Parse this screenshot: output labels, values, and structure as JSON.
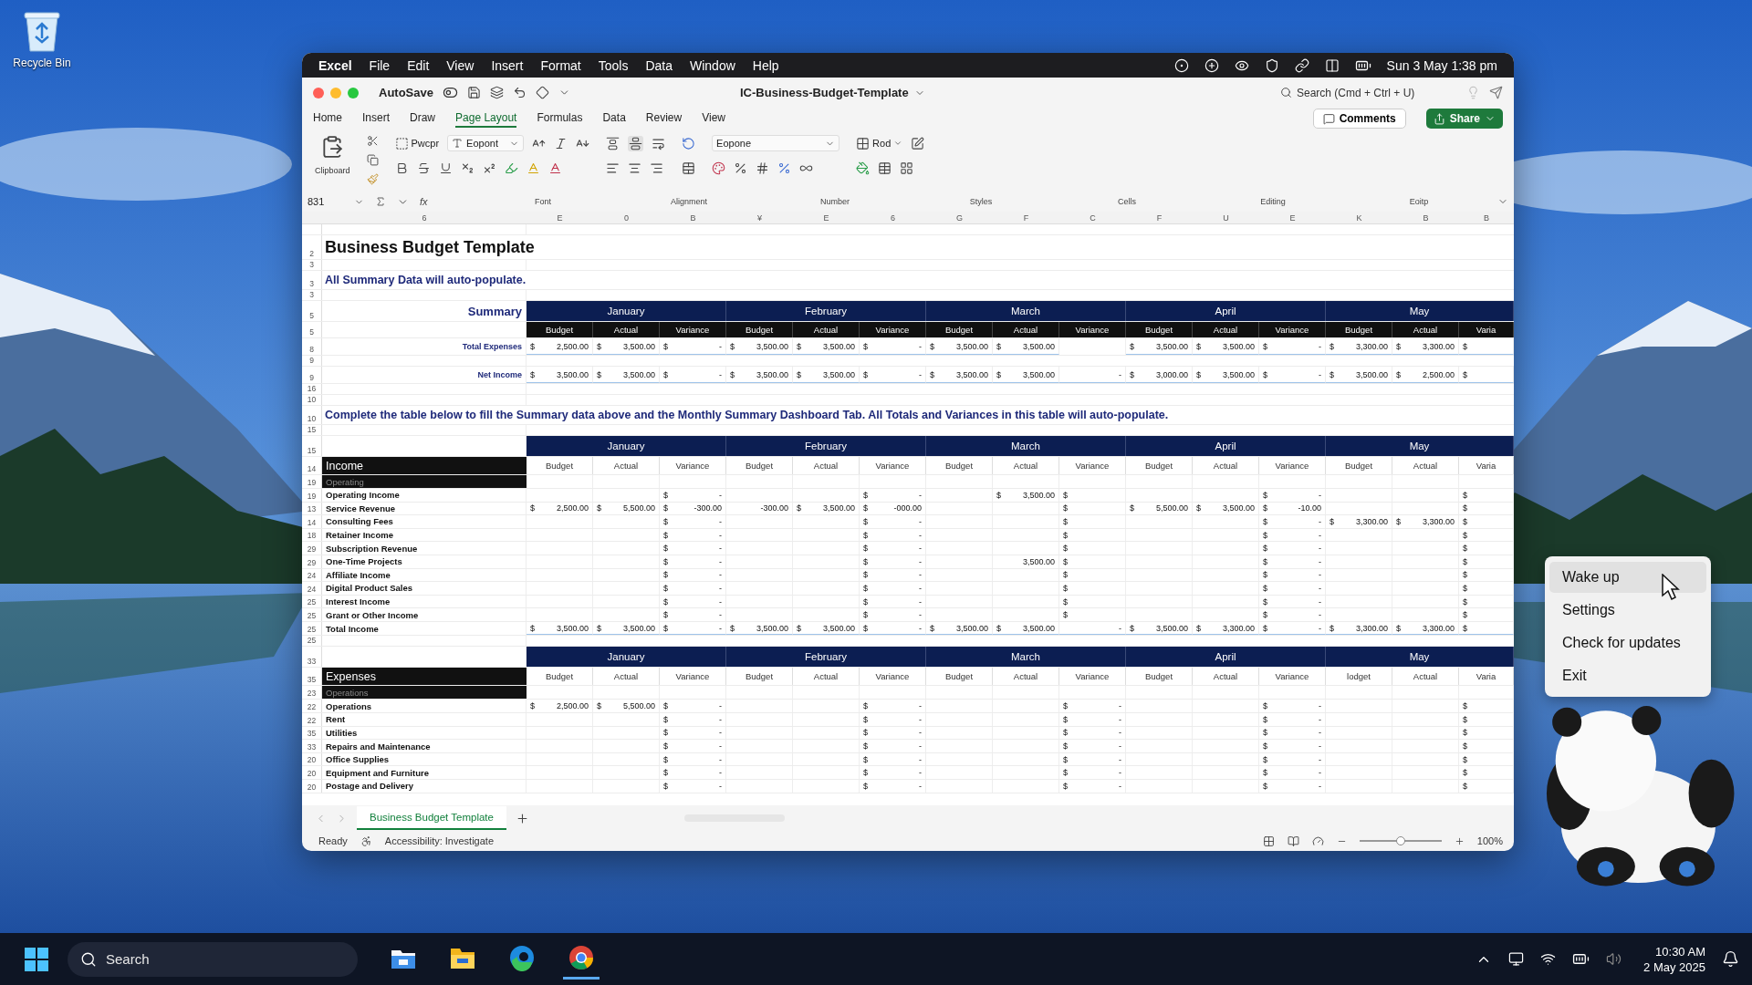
{
  "desktop": {
    "recycle_bin": "Recycle Bin"
  },
  "menu_bar": {
    "app": "Excel",
    "items": [
      "File",
      "Edit",
      "View",
      "Insert",
      "Format",
      "Tools",
      "Data",
      "Window",
      "Help"
    ],
    "clock": "Sun 3 May  1:38 pm"
  },
  "title_bar": {
    "autosave": "AutoSave",
    "document": "IC-Business-Budget-Template",
    "search_placeholder": "Search (Cmd + Ctrl + U)"
  },
  "ribbon_tabs": [
    {
      "label": "Home",
      "selected": false
    },
    {
      "label": "Insert",
      "selected": false
    },
    {
      "label": "Draw",
      "selected": false
    },
    {
      "label": "Page Layout",
      "selected": true
    },
    {
      "label": "Formulas",
      "selected": false
    },
    {
      "label": "Data",
      "selected": false
    },
    {
      "label": "Review",
      "selected": false
    },
    {
      "label": "View",
      "selected": false
    }
  ],
  "comments": "Comments",
  "share": "Share",
  "ribbon": {
    "clipboard": "Clipboard",
    "style_button": "Pwcpr",
    "font": "Eopont",
    "number_format": "Eopone",
    "styles_button": "Rod"
  },
  "group_labels": [
    "Font",
    "Alignment",
    "Number",
    "Styles",
    "Cells",
    "Editing",
    "Eoitp"
  ],
  "formula_bar": {
    "name_box": "831",
    "function_label": "fx"
  },
  "sheet": {
    "column_letters": [
      "6",
      "E",
      "0",
      "B",
      "¥",
      "E",
      "6",
      "G",
      "F",
      "C",
      "F",
      "U",
      "E",
      "K",
      "B",
      "B"
    ],
    "rows": [
      {
        "kind": "blank"
      },
      {
        "kind": "title",
        "number": "2",
        "text": "Business Budget Template"
      },
      {
        "kind": "blank",
        "number": "3"
      },
      {
        "kind": "note",
        "number": "3",
        "text": "All Summary Data will auto-populate."
      },
      {
        "kind": "blank",
        "number": "3"
      },
      {
        "kind": "months",
        "number": "5",
        "label": "Summary",
        "months": [
          "January",
          "February",
          "March",
          "April",
          "May"
        ]
      },
      {
        "kind": "summary_header",
        "number": "5",
        "headers": [
          "Budget",
          "Actual",
          "Variance",
          "Budget",
          "Actual",
          "Variance",
          "Budget",
          "Actual",
          "Variance",
          "Budget",
          "Actual",
          "Variance",
          "Budget",
          "Actual",
          "Varia"
        ]
      },
      {
        "kind": "summary_row",
        "number": "8",
        "label": "Total Expenses",
        "cells": [
          {
            "sym": "$",
            "val": "2,500.00"
          },
          {
            "sym": "$",
            "val": "3,500.00"
          },
          {
            "sym": "$",
            "val": "-"
          },
          {
            "sym": "$",
            "val": "3,500.00"
          },
          {
            "sym": "$",
            "val": "3,500.00"
          },
          {
            "sym": "$",
            "val": "-"
          },
          {
            "sym": "$",
            "val": "3,500.00"
          },
          {
            "sym": "$",
            "val": "3,500.00"
          },
          null,
          {
            "sym": "$",
            "val": "3,500.00"
          },
          {
            "sym": "$",
            "val": "3,500.00"
          },
          {
            "sym": "$",
            "val": "-"
          },
          {
            "sym": "$",
            "val": "3,300.00"
          },
          {
            "sym": "$",
            "val": "3,300.00"
          },
          {
            "sym": "$"
          }
        ]
      },
      {
        "kind": "blank",
        "number": "9"
      },
      {
        "kind": "summary_row",
        "number": "9",
        "label": "Net Income",
        "cells": [
          {
            "sym": "$",
            "val": "3,500.00"
          },
          {
            "sym": "$",
            "val": "3,500.00"
          },
          {
            "sym": "$",
            "val": "-"
          },
          {
            "sym": "$",
            "val": "3,500.00"
          },
          {
            "sym": "$",
            "val": "3,500.00"
          },
          {
            "sym": "$",
            "val": "-"
          },
          {
            "sym": "$",
            "val": "3,500.00"
          },
          {
            "sym": "$",
            "val": "3,500.00"
          },
          {
            "val": "-"
          },
          {
            "sym": "$",
            "val": "3,000.00"
          },
          {
            "sym": "$",
            "val": "3,500.00"
          },
          {
            "sym": "$",
            "val": "-"
          },
          {
            "sym": "$",
            "val": "3,500.00"
          },
          {
            "sym": "$",
            "val": "2,500.00"
          },
          {
            "sym": "$"
          }
        ]
      },
      {
        "kind": "blank",
        "number": "16"
      },
      {
        "kind": "blank",
        "number": "10"
      },
      {
        "kind": "note",
        "number": "10",
        "text": "Complete the table below to fill the Summary data above and the Monthly Summary Dashboard Tab.  All Totals and Variances in this table will auto-populate."
      },
      {
        "kind": "blank",
        "number": "15"
      },
      {
        "kind": "months",
        "number": "15",
        "months": [
          "January",
          "February",
          "March",
          "April",
          "May"
        ]
      },
      {
        "kind": "section_header",
        "number": "14",
        "label": "Income",
        "headers": [
          "Budget",
          "Actual",
          "Variance",
          "Budget",
          "Actual",
          "Variance",
          "Budget",
          "Actual",
          "Variance",
          "Budget",
          "Actual",
          "Variance",
          "Budget",
          "Actual",
          "Varia"
        ]
      },
      {
        "kind": "group",
        "number": "19",
        "label": "Operating"
      },
      {
        "kind": "item",
        "number": "19",
        "label": "Operating Income",
        "cells": [
          null,
          null,
          {
            "sym": "$",
            "val": "-"
          },
          null,
          null,
          {
            "sym": "$",
            "val": "-"
          },
          null,
          {
            "sym": "$",
            "val": "3,500.00"
          },
          {
            "sym": "$"
          },
          null,
          null,
          {
            "sym": "$",
            "val": "-"
          },
          null,
          null,
          {
            "sym": "$"
          }
        ]
      },
      {
        "kind": "item",
        "number": "13",
        "label": "Service Revenue",
        "cells": [
          {
            "sym": "$",
            "val": "2,500.00"
          },
          {
            "sym": "$",
            "val": "5,500.00"
          },
          {
            "sym": "$",
            "val": "-300.00"
          },
          {
            "val": "-300.00"
          },
          {
            "sym": "$",
            "val": "3,500.00"
          },
          {
            "sym": "$",
            "val": "-000.00"
          },
          null,
          null,
          {
            "sym": "$"
          },
          {
            "sym": "$",
            "val": "5,500.00"
          },
          {
            "sym": "$",
            "val": "3,500.00"
          },
          {
            "sym": "$",
            "val": "-10.00"
          },
          null,
          null,
          {
            "sym": "$"
          }
        ]
      },
      {
        "kind": "item",
        "number": "14",
        "label": "Consulting Fees",
        "cells": [
          null,
          null,
          {
            "sym": "$",
            "val": "-"
          },
          null,
          null,
          {
            "sym": "$",
            "val": "-"
          },
          null,
          null,
          {
            "sym": "$"
          },
          null,
          null,
          {
            "sym": "$",
            "val": "-"
          },
          {
            "sym": "$",
            "val": "3,300.00"
          },
          {
            "sym": "$",
            "val": "3,300.00"
          },
          {
            "sym": "$"
          }
        ]
      },
      {
        "kind": "item",
        "number": "18",
        "label": "Retainer Income",
        "cells": [
          null,
          null,
          {
            "sym": "$",
            "val": "-"
          },
          null,
          null,
          {
            "sym": "$",
            "val": "-"
          },
          null,
          null,
          {
            "sym": "$"
          },
          null,
          null,
          {
            "sym": "$",
            "val": "-"
          },
          null,
          null,
          {
            "sym": "$"
          }
        ]
      },
      {
        "kind": "item",
        "number": "29",
        "label": "Subscription Revenue",
        "cells": [
          null,
          null,
          {
            "sym": "$",
            "val": "-"
          },
          null,
          null,
          {
            "sym": "$",
            "val": "-"
          },
          null,
          null,
          {
            "sym": "$"
          },
          null,
          null,
          {
            "sym": "$",
            "val": "-"
          },
          null,
          null,
          {
            "sym": "$"
          }
        ]
      },
      {
        "kind": "item",
        "number": "29",
        "label": "One-Time Projects",
        "cells": [
          null,
          null,
          {
            "sym": "$",
            "val": "-"
          },
          null,
          null,
          {
            "sym": "$",
            "val": "-"
          },
          null,
          {
            "val": "3,500.00"
          },
          {
            "sym": "$"
          },
          null,
          null,
          {
            "sym": "$",
            "val": "-"
          },
          null,
          null,
          {
            "sym": "$"
          }
        ]
      },
      {
        "kind": "item",
        "number": "24",
        "label": "Affiliate Income",
        "cells": [
          null,
          null,
          {
            "sym": "$",
            "val": "-"
          },
          null,
          null,
          {
            "sym": "$",
            "val": "-"
          },
          null,
          null,
          {
            "sym": "$"
          },
          null,
          null,
          {
            "sym": "$",
            "val": "-"
          },
          null,
          null,
          {
            "sym": "$"
          }
        ]
      },
      {
        "kind": "item",
        "number": "24",
        "label": "Digital Product Sales",
        "cells": [
          null,
          null,
          {
            "sym": "$",
            "val": "-"
          },
          null,
          null,
          {
            "sym": "$",
            "val": "-"
          },
          null,
          null,
          {
            "sym": "$"
          },
          null,
          null,
          {
            "sym": "$",
            "val": "-"
          },
          null,
          null,
          {
            "sym": "$"
          }
        ]
      },
      {
        "kind": "item",
        "number": "25",
        "label": "Interest Income",
        "cells": [
          null,
          null,
          {
            "sym": "$",
            "val": "-"
          },
          null,
          null,
          {
            "sym": "$",
            "val": "-"
          },
          null,
          null,
          {
            "sym": "$"
          },
          null,
          null,
          {
            "sym": "$",
            "val": "-"
          },
          null,
          null,
          {
            "sym": "$"
          }
        ]
      },
      {
        "kind": "item",
        "number": "25",
        "label": "Grant or Other Income",
        "cells": [
          null,
          null,
          {
            "sym": "$",
            "val": "-"
          },
          null,
          null,
          {
            "sym": "$",
            "val": "-"
          },
          null,
          null,
          {
            "sym": "$"
          },
          null,
          null,
          {
            "sym": "$",
            "val": "-"
          },
          null,
          null,
          {
            "sym": "$"
          }
        ]
      },
      {
        "kind": "total",
        "number": "25",
        "label": "Total Income",
        "cells": [
          {
            "sym": "$",
            "val": "3,500.00"
          },
          {
            "sym": "$",
            "val": "3,500.00"
          },
          {
            "sym": "$",
            "val": "-"
          },
          {
            "sym": "$",
            "val": "3,500.00"
          },
          {
            "sym": "$",
            "val": "3,500.00"
          },
          {
            "sym": "$",
            "val": "-"
          },
          {
            "sym": "$",
            "val": "3,500.00"
          },
          {
            "sym": "$",
            "val": "3,500.00"
          },
          {
            "val": "-"
          },
          {
            "sym": "$",
            "val": "3,500.00"
          },
          {
            "sym": "$",
            "val": "3,300.00"
          },
          {
            "sym": "$",
            "val": "-"
          },
          {
            "sym": "$",
            "val": "3,300.00"
          },
          {
            "sym": "$",
            "val": "3,300.00"
          },
          {
            "sym": "$"
          }
        ]
      },
      {
        "kind": "blank",
        "number": "25"
      },
      {
        "kind": "months",
        "number": "33",
        "months": [
          "January",
          "February",
          "March",
          "April",
          "May"
        ]
      },
      {
        "kind": "section_header",
        "number": "35",
        "label": "Expenses",
        "headers": [
          "Budget",
          "Actual",
          "Variance",
          "Budget",
          "Actual",
          "Variance",
          "Budget",
          "Actual",
          "Variance",
          "Budget",
          "Actual",
          "Variance",
          "lodget",
          "Actual",
          "Varia"
        ]
      },
      {
        "kind": "group",
        "number": "23",
        "label": "Operations"
      },
      {
        "kind": "item",
        "number": "22",
        "label": "Operations",
        "cells": [
          {
            "sym": "$",
            "val": "2,500.00"
          },
          {
            "sym": "$",
            "val": "5,500.00"
          },
          {
            "sym": "$",
            "val": "-"
          },
          null,
          null,
          {
            "sym": "$",
            "val": "-"
          },
          null,
          null,
          {
            "sym": "$",
            "val": "-"
          },
          null,
          null,
          {
            "sym": "$",
            "val": "-"
          },
          null,
          null,
          {
            "sym": "$"
          }
        ]
      },
      {
        "kind": "item",
        "number": "22",
        "label": "Rent",
        "cells": [
          null,
          null,
          {
            "sym": "$",
            "val": "-"
          },
          null,
          null,
          {
            "sym": "$",
            "val": "-"
          },
          null,
          null,
          {
            "sym": "$",
            "val": "-"
          },
          null,
          null,
          {
            "sym": "$",
            "val": "-"
          },
          null,
          null,
          {
            "sym": "$"
          }
        ]
      },
      {
        "kind": "item",
        "number": "35",
        "label": "Utilities",
        "cells": [
          null,
          null,
          {
            "sym": "$",
            "val": "-"
          },
          null,
          null,
          {
            "sym": "$",
            "val": "-"
          },
          null,
          null,
          {
            "sym": "$",
            "val": "-"
          },
          null,
          null,
          {
            "sym": "$",
            "val": "-"
          },
          null,
          null,
          {
            "sym": "$"
          }
        ]
      },
      {
        "kind": "item",
        "number": "33",
        "label": "Repairs and Maintenance",
        "cells": [
          null,
          null,
          {
            "sym": "$",
            "val": "-"
          },
          null,
          null,
          {
            "sym": "$",
            "val": "-"
          },
          null,
          null,
          {
            "sym": "$",
            "val": "-"
          },
          null,
          null,
          {
            "sym": "$",
            "val": "-"
          },
          null,
          null,
          {
            "sym": "$"
          }
        ]
      },
      {
        "kind": "item",
        "number": "20",
        "label": "Office Supplies",
        "cells": [
          null,
          null,
          {
            "sym": "$",
            "val": "-"
          },
          null,
          null,
          {
            "sym": "$",
            "val": "-"
          },
          null,
          null,
          {
            "sym": "$",
            "val": "-"
          },
          null,
          null,
          {
            "sym": "$",
            "val": "-"
          },
          null,
          null,
          {
            "sym": "$"
          }
        ]
      },
      {
        "kind": "item",
        "number": "20",
        "label": "Equipment and Furniture",
        "cells": [
          null,
          null,
          {
            "sym": "$",
            "val": "-"
          },
          null,
          null,
          {
            "sym": "$",
            "val": "-"
          },
          null,
          null,
          {
            "sym": "$",
            "val": "-"
          },
          null,
          null,
          {
            "sym": "$",
            "val": "-"
          },
          null,
          null,
          {
            "sym": "$"
          }
        ]
      },
      {
        "kind": "item",
        "number": "20",
        "label": "Postage and Delivery",
        "cells": [
          null,
          null,
          {
            "sym": "$",
            "val": "-"
          },
          null,
          null,
          {
            "sym": "$",
            "val": "-"
          },
          null,
          null,
          {
            "sym": "$",
            "val": "-"
          },
          null,
          null,
          {
            "sym": "$",
            "val": "-"
          },
          null,
          null,
          {
            "sym": "$"
          }
        ]
      }
    ]
  },
  "sheet_tabs": [
    {
      "label": "Business Budget Template",
      "selected": true
    }
  ],
  "status_bar": {
    "ready": "Ready",
    "accessibility": "Accessibility: Investigate",
    "zoom": "100%",
    "zoom_slider": {
      "level": 0.5
    }
  },
  "context_menu": [
    {
      "label": "Wake up",
      "selected": true
    },
    {
      "label": "Settings",
      "selected": false
    },
    {
      "label": "Check for updates",
      "selected": false
    },
    {
      "label": "Exit",
      "selected": false
    }
  ],
  "taskbar": {
    "search_placeholder": "Search",
    "apps": [
      {
        "kind": "explorer",
        "active": false
      },
      {
        "kind": "folder",
        "active": false
      },
      {
        "kind": "edge",
        "active": false
      },
      {
        "kind": "chrome",
        "active": true
      }
    ],
    "time": "10:30 AM",
    "date": "2 May 2025"
  }
}
